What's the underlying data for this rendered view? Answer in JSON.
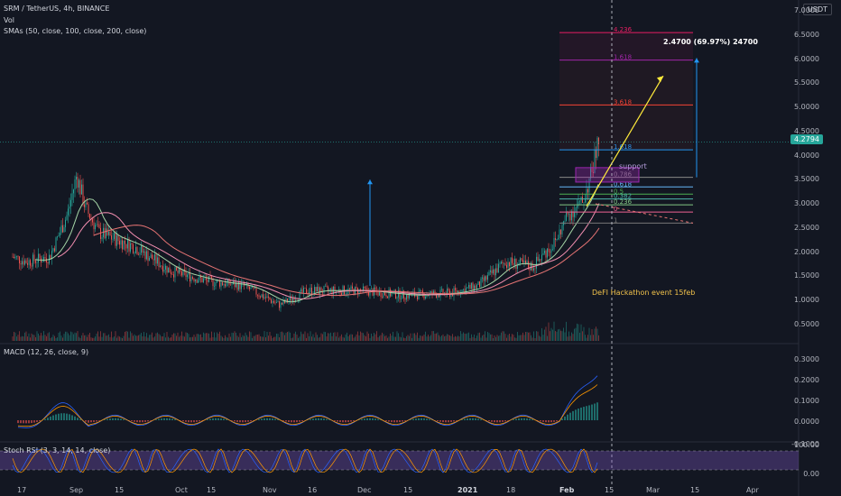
{
  "header": {
    "symbol_line": "SRM / TetherUS, 4h, BINANCE",
    "vol_label": "Vol",
    "sma_label": "SMAs (50, close, 100, close, 200, close)",
    "currency_button": "USDT"
  },
  "price_badge": "4.2794",
  "annotations": {
    "measure": "2.4700 (69.97%) 24700",
    "support": "support",
    "event": "DeFI Hackathon event 15feb",
    "fib_labels": [
      "4.236",
      "1.618",
      "3.618",
      "1.618",
      "0.786",
      "0.618",
      "0.5",
      "0.382",
      "0.236",
      "0",
      "1"
    ]
  },
  "panels": {
    "macd_label": "MACD (12, 26, close, 9)",
    "stoch_label": "Stoch RSI (3, 3, 14, 14, close)"
  },
  "axes": {
    "price_ticks": [
      "7.0000",
      "6.5000",
      "6.0000",
      "5.5000",
      "5.0000",
      "4.5000",
      "4.0000",
      "3.5000",
      "3.0000",
      "2.5000",
      "2.0000",
      "1.5000",
      "1.0000",
      "0.5000"
    ],
    "macd_ticks": [
      "0.3000",
      "0.2000",
      "0.1000",
      "0.0000",
      "-0.1000"
    ],
    "stoch_ticks": [
      "100.00",
      "0.00"
    ],
    "x_ticks": [
      "17",
      "Sep",
      "15",
      "Oct",
      "15",
      "Nov",
      "16",
      "Dec",
      "15",
      "2021",
      "18",
      "Feb",
      "15",
      "Mar",
      "15",
      "Apr"
    ]
  },
  "chart_data": {
    "type": "candlestick",
    "title": "SRM / TetherUS, 4h, BINANCE",
    "ylim": [
      0,
      7
    ],
    "price_path": [
      [
        "17",
        1.9
      ],
      [
        "Sep",
        3.6
      ],
      [
        "15",
        2.4
      ],
      [
        "Oct",
        1.6
      ],
      [
        "15",
        1.3
      ],
      [
        "Nov",
        0.9
      ],
      [
        "16",
        1.2
      ],
      [
        "Dec",
        1.2
      ],
      [
        "15",
        1.1
      ],
      [
        "2021",
        1.2
      ],
      [
        "18",
        1.7
      ],
      [
        "Feb",
        2.4
      ],
      [
        "Feb",
        3.0
      ],
      [
        "Feb",
        4.28
      ]
    ],
    "last_price": 4.2794,
    "fib_levels": [
      {
        "label": "4.236",
        "price": 6.55
      },
      {
        "label": "1.618",
        "price": 5.98
      },
      {
        "label": "3.618",
        "price": 5.05
      },
      {
        "label": "1.618",
        "price": 4.12
      },
      {
        "label": "1",
        "price": 3.55
      },
      {
        "label": "0.786",
        "price": 3.35
      },
      {
        "label": "0.618",
        "price": 3.2
      },
      {
        "label": "0.5",
        "price": 3.1
      },
      {
        "label": "0.382",
        "price": 2.98
      },
      {
        "label": "0.236",
        "price": 2.83
      },
      {
        "label": "0",
        "price": 2.6
      }
    ],
    "measure_range": [
      3.55,
      6.02
    ],
    "colors": {
      "up": "#26a69a",
      "down": "#ef5350",
      "sma50": "#a5d6a7",
      "sma100": "#f48fb1",
      "sma200": "#e57373",
      "macd": "#2962ff",
      "signal": "#ff9800",
      "stoch": "#7e57c2"
    }
  }
}
